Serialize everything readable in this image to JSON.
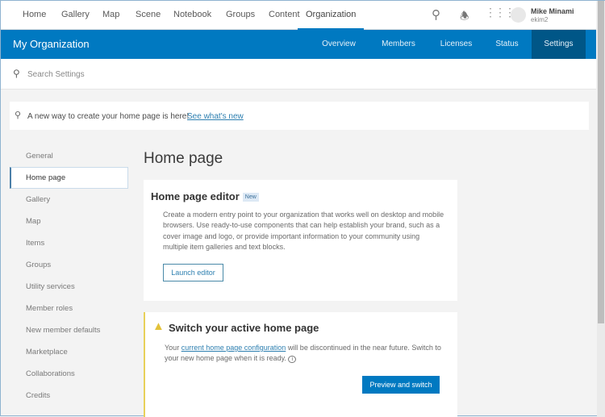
{
  "topnav": {
    "items": [
      "Home",
      "Gallery",
      "Map",
      "Scene",
      "Notebook",
      "Groups",
      "Content",
      "Organization"
    ],
    "active": "Organization",
    "user_name": "Mike Minami",
    "user_id": "ekim2"
  },
  "org_bar": {
    "title": "My Organization",
    "tabs": [
      "Overview",
      "Members",
      "Licenses",
      "Status",
      "Settings"
    ],
    "active": "Settings"
  },
  "search": {
    "placeholder": "Search Settings"
  },
  "banner": {
    "text": "A new way to create your home page is here!",
    "link": "See what's new"
  },
  "sidebar": {
    "items": [
      "General",
      "Home page",
      "Gallery",
      "Map",
      "Items",
      "Groups",
      "Utility services",
      "Member roles",
      "New member defaults",
      "Marketplace",
      "Collaborations",
      "Credits"
    ],
    "selected": "Home page"
  },
  "main": {
    "title": "Home page",
    "editor_card": {
      "title": "Home page editor",
      "badge": "New",
      "description": "Create a modern entry point to your organization that works well on desktop and mobile browsers. Use ready-to-use components that can help establish your brand, such as a cover image and logo, or provide important information to your community using multiple item galleries and text blocks.",
      "button": "Launch editor"
    },
    "switch_card": {
      "title": "Switch your active home page",
      "text_before": "Your",
      "link": "current home page configuration",
      "text_after": "will be discontinued in the near future. Switch to your new home page when it is ready.",
      "button": "Preview and switch"
    }
  },
  "colors": {
    "brand": "#0079c1",
    "warning": "#e8d15a"
  }
}
